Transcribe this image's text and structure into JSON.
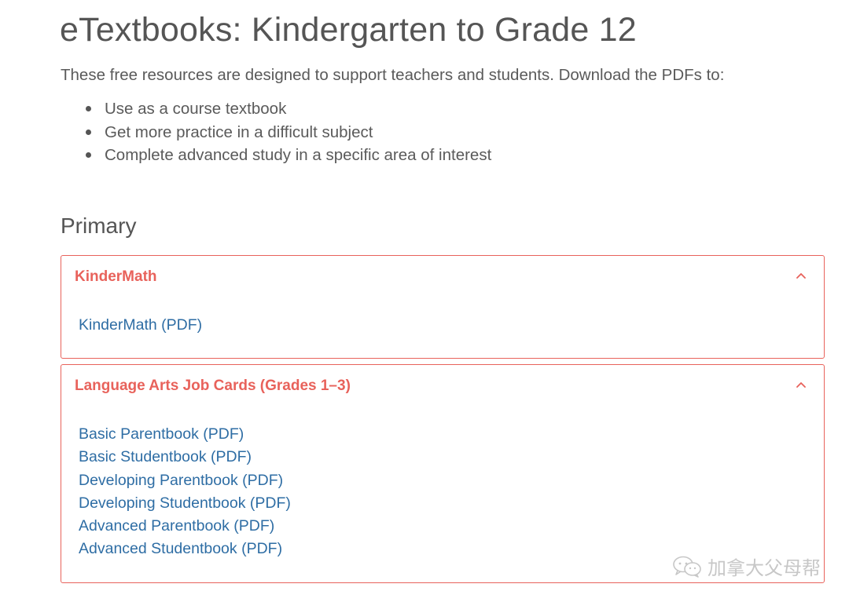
{
  "page": {
    "title": "eTextbooks: Kindergarten to Grade 12",
    "intro": "These free resources are designed to support teachers and students. Download the PDFs to:",
    "bullets": [
      "Use as a course textbook",
      "Get more practice in a difficult subject",
      "Complete advanced study in a specific area of interest"
    ]
  },
  "section": {
    "title": "Primary"
  },
  "panels": [
    {
      "heading": "KinderMath",
      "expanded": true,
      "icon": "chevron-up-icon",
      "links": [
        "KinderMath (PDF)"
      ]
    },
    {
      "heading": "Language Arts Job Cards (Grades 1–3)",
      "expanded": true,
      "icon": "chevron-up-icon",
      "links": [
        "Basic Parentbook (PDF)",
        "Basic Studentbook (PDF)",
        "Developing Parentbook (PDF)",
        "Developing Studentbook (PDF)",
        "Advanced Parentbook (PDF)",
        "Advanced Studentbook (PDF)"
      ]
    }
  ],
  "watermark": {
    "text": "加拿大父母帮",
    "icon": "wechat-icon"
  },
  "colors": {
    "accent": "#e8625b",
    "link": "#2e6da4",
    "text": "#5a5a5a"
  }
}
